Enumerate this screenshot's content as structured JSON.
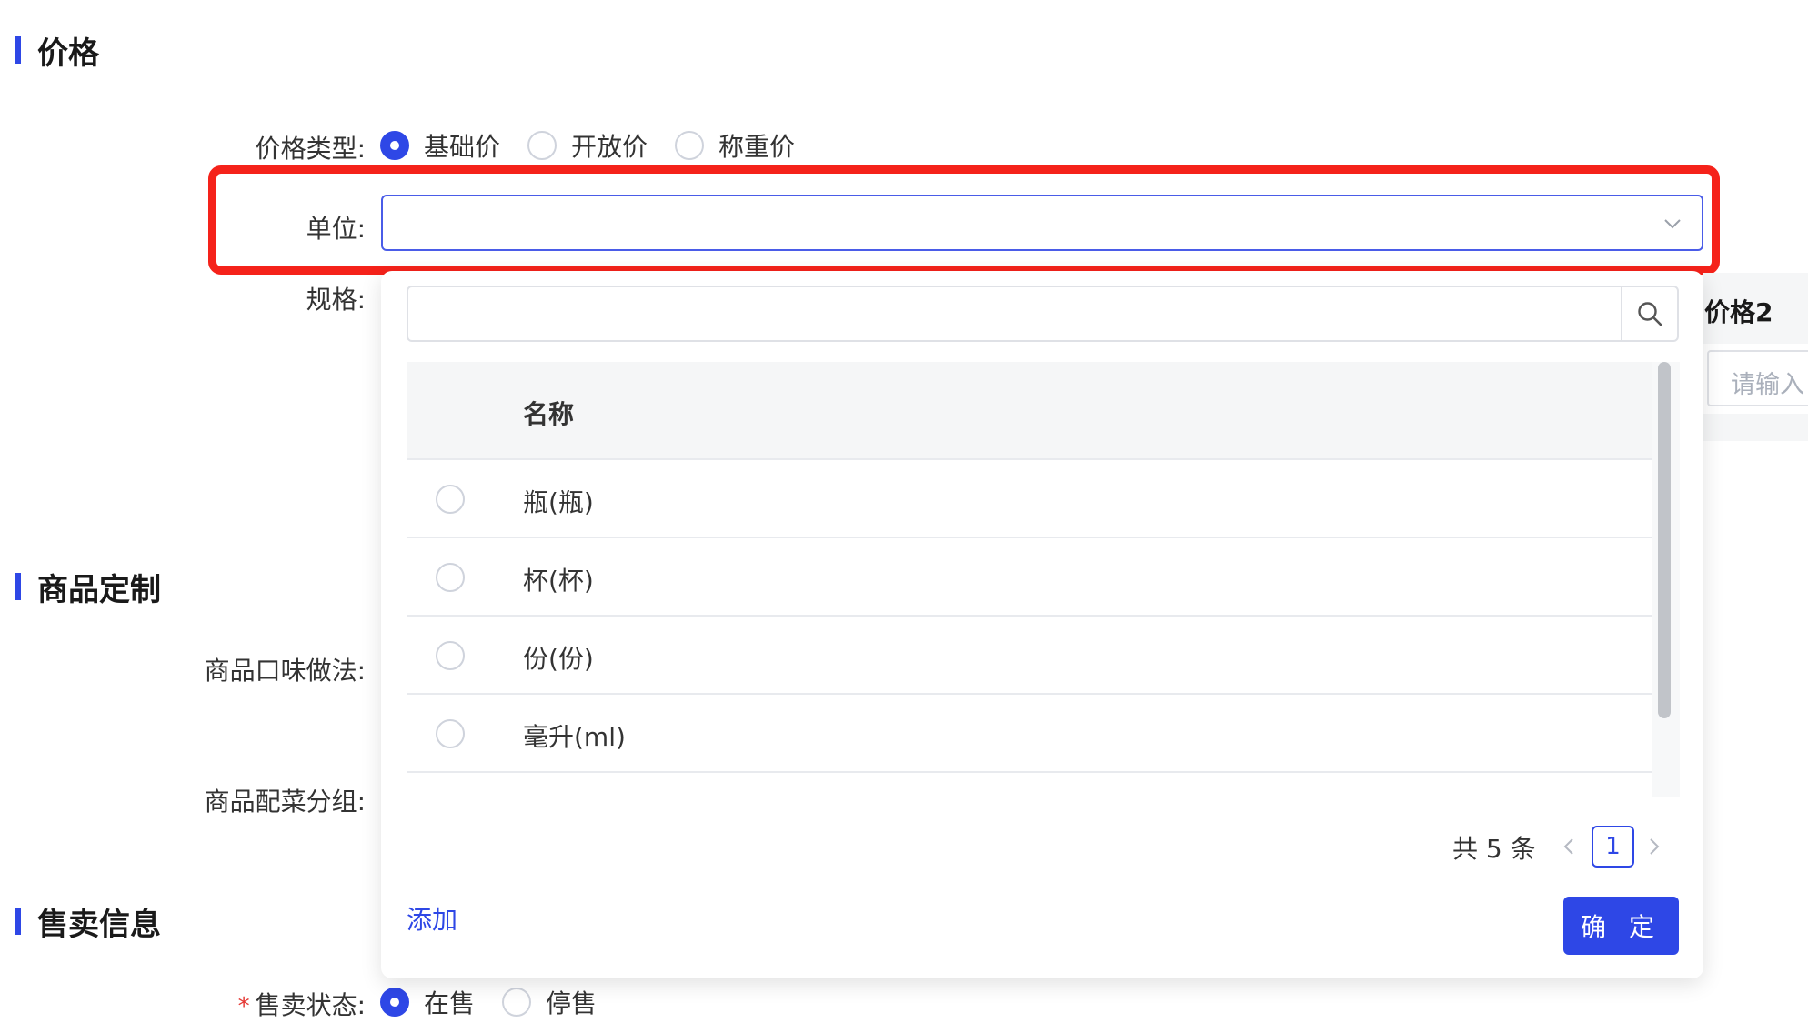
{
  "sections": {
    "price": "价格",
    "customize": "商品定制",
    "sales": "售卖信息"
  },
  "form": {
    "price_type_label": "价格类型:",
    "price_type_options": [
      "基础价",
      "开放价",
      "称重价"
    ],
    "price_type_selected": "基础价",
    "unit_label": "单位:",
    "unit_value": "",
    "spec_label": "规格:",
    "flavor_label": "商品口味做法:",
    "side_group_label": "商品配菜分组:",
    "sale_status_required_mark": "*",
    "sale_status_label": "售卖状态:",
    "sale_status_options": [
      "在售",
      "停售"
    ],
    "sale_status_selected": "在售"
  },
  "background": {
    "price2_header": "价格2",
    "price2_placeholder": "请输入"
  },
  "dropdown": {
    "search_placeholder": "",
    "column_name": "名称",
    "rows": [
      "瓶(瓶)",
      "杯(杯)",
      "份(份)",
      "毫升(ml)"
    ],
    "pager_total": "共 5 条",
    "current_page": "1",
    "add_label": "添加",
    "confirm_label": "确 定"
  },
  "colors": {
    "accent": "#2e47e6",
    "highlight": "#f5221a"
  }
}
